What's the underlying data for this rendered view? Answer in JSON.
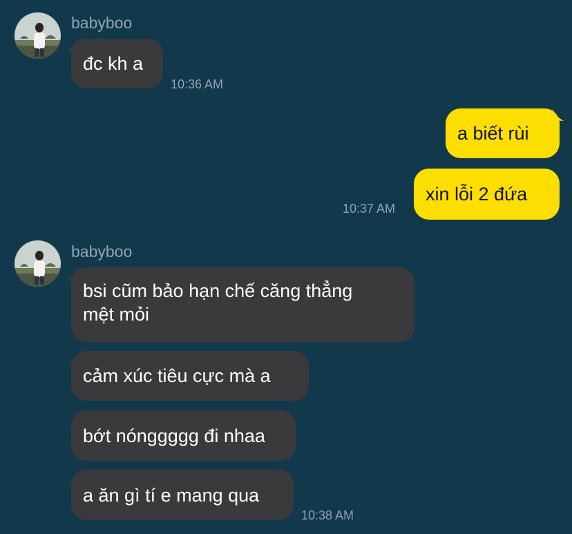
{
  "colors": {
    "background": "#12384c",
    "incoming_bubble": "#3a3a3c",
    "outgoing_bubble": "#fcde00",
    "meta_text": "#8fa4b2"
  },
  "groups": [
    {
      "sender": "babyboo",
      "avatar": "user-avatar-photo",
      "messages": [
        "đc kh a"
      ],
      "time": "10:36 AM"
    },
    {
      "outgoing": true,
      "messages": [
        "a biết rùi",
        "xin lỗi 2 đứa"
      ],
      "time": "10:37 AM"
    },
    {
      "sender": "babyboo",
      "avatar": "user-avatar-photo",
      "messages": [
        "bsi cũm bảo hạn chế căng thẳng\nmệt mỏi",
        "cảm xúc tiêu cực mà a",
        "bớt nónggggg đi nhaa",
        "a ăn gì tí e mang qua"
      ],
      "time": "10:38 AM"
    }
  ]
}
